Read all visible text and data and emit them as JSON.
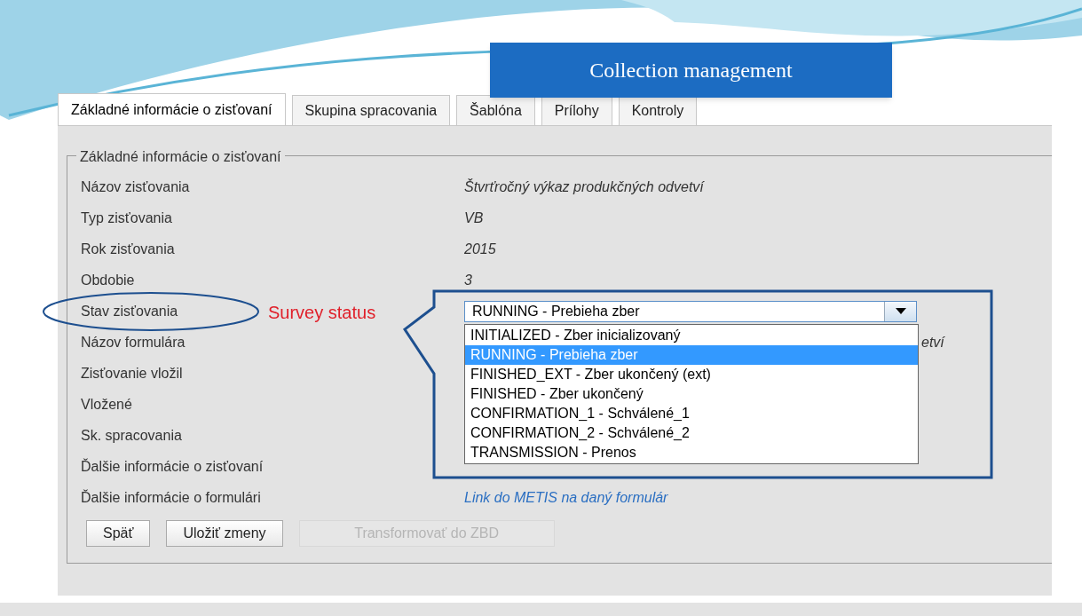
{
  "banner": {
    "title": "Collection management"
  },
  "tabs": [
    {
      "label": "Základné informácie o zisťovaní",
      "selected": true
    },
    {
      "label": "Skupina spracovania",
      "selected": false
    },
    {
      "label": "Šablóna",
      "selected": false
    },
    {
      "label": "Prílohy",
      "selected": false
    },
    {
      "label": "Kontroly",
      "selected": false
    }
  ],
  "fieldset": {
    "legend": "Základné informácie o zisťovaní",
    "rows": [
      {
        "label": "Názov zisťovania",
        "kind": "text",
        "value": "Štvrťročný výkaz produkčných odvetví"
      },
      {
        "label": "Typ zisťovania",
        "kind": "text",
        "value": "VB"
      },
      {
        "label": "Rok zisťovania",
        "kind": "text",
        "value": "2015"
      },
      {
        "label": "Obdobie",
        "kind": "text",
        "value": "3"
      },
      {
        "label": "Stav zisťovania",
        "kind": "select"
      },
      {
        "label": "Názov formulára",
        "kind": "tail",
        "value": "etví"
      },
      {
        "label": "Zisťovanie vložil",
        "kind": "none"
      },
      {
        "label": "Vložené",
        "kind": "none"
      },
      {
        "label": "Sk. spracovania",
        "kind": "none"
      },
      {
        "label": "Ďalšie informácie o zisťovaní",
        "kind": "none"
      },
      {
        "label": "Ďalšie informácie o formulári",
        "kind": "link",
        "value": "Link do METIS na daný formulár"
      }
    ]
  },
  "select": {
    "value": "RUNNING - Prebieha zber",
    "expanded": true,
    "options": [
      {
        "label": "INITIALIZED - Zber inicializovaný",
        "selected": false
      },
      {
        "label": "RUNNING - Prebieha zber",
        "selected": true
      },
      {
        "label": "FINISHED_EXT - Zber ukončený (ext)",
        "selected": false
      },
      {
        "label": "FINISHED - Zber ukončený",
        "selected": false
      },
      {
        "label": "CONFIRMATION_1 - Schválené_1",
        "selected": false
      },
      {
        "label": "CONFIRMATION_2 - Schválené_2",
        "selected": false
      },
      {
        "label": "TRANSMISSION - Prenos",
        "selected": false
      }
    ]
  },
  "buttons": [
    {
      "label": "Späť",
      "disabled": false
    },
    {
      "label": "Uložiť zmeny",
      "disabled": false
    },
    {
      "label": "Transformovať do ZBD",
      "disabled": true
    }
  ],
  "annotation": {
    "label": "Survey status"
  }
}
